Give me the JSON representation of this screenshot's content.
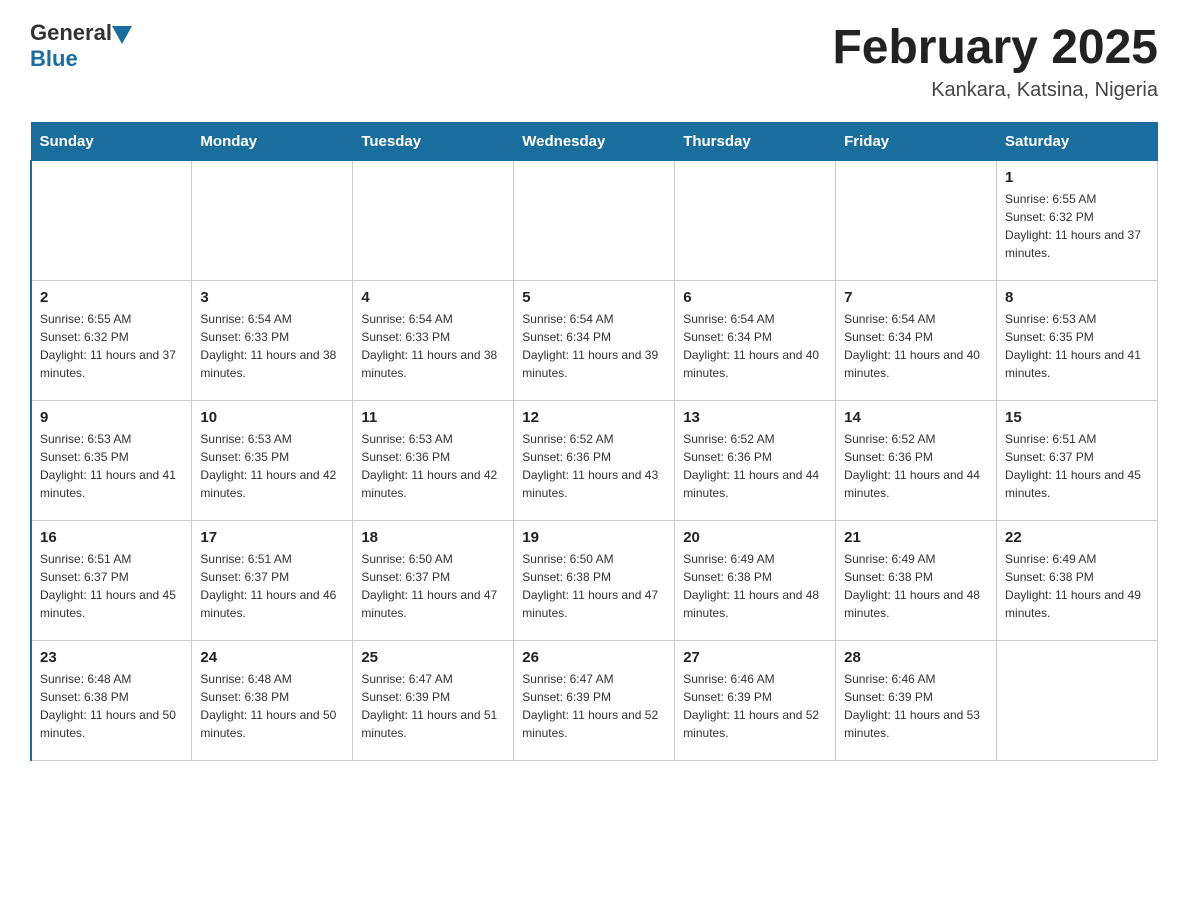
{
  "logo": {
    "general": "General",
    "blue": "Blue"
  },
  "title": "February 2025",
  "subtitle": "Kankara, Katsina, Nigeria",
  "weekdays": [
    "Sunday",
    "Monday",
    "Tuesday",
    "Wednesday",
    "Thursday",
    "Friday",
    "Saturday"
  ],
  "weeks": [
    [
      {
        "day": "",
        "info": ""
      },
      {
        "day": "",
        "info": ""
      },
      {
        "day": "",
        "info": ""
      },
      {
        "day": "",
        "info": ""
      },
      {
        "day": "",
        "info": ""
      },
      {
        "day": "",
        "info": ""
      },
      {
        "day": "1",
        "info": "Sunrise: 6:55 AM\nSunset: 6:32 PM\nDaylight: 11 hours and 37 minutes."
      }
    ],
    [
      {
        "day": "2",
        "info": "Sunrise: 6:55 AM\nSunset: 6:32 PM\nDaylight: 11 hours and 37 minutes."
      },
      {
        "day": "3",
        "info": "Sunrise: 6:54 AM\nSunset: 6:33 PM\nDaylight: 11 hours and 38 minutes."
      },
      {
        "day": "4",
        "info": "Sunrise: 6:54 AM\nSunset: 6:33 PM\nDaylight: 11 hours and 38 minutes."
      },
      {
        "day": "5",
        "info": "Sunrise: 6:54 AM\nSunset: 6:34 PM\nDaylight: 11 hours and 39 minutes."
      },
      {
        "day": "6",
        "info": "Sunrise: 6:54 AM\nSunset: 6:34 PM\nDaylight: 11 hours and 40 minutes."
      },
      {
        "day": "7",
        "info": "Sunrise: 6:54 AM\nSunset: 6:34 PM\nDaylight: 11 hours and 40 minutes."
      },
      {
        "day": "8",
        "info": "Sunrise: 6:53 AM\nSunset: 6:35 PM\nDaylight: 11 hours and 41 minutes."
      }
    ],
    [
      {
        "day": "9",
        "info": "Sunrise: 6:53 AM\nSunset: 6:35 PM\nDaylight: 11 hours and 41 minutes."
      },
      {
        "day": "10",
        "info": "Sunrise: 6:53 AM\nSunset: 6:35 PM\nDaylight: 11 hours and 42 minutes."
      },
      {
        "day": "11",
        "info": "Sunrise: 6:53 AM\nSunset: 6:36 PM\nDaylight: 11 hours and 42 minutes."
      },
      {
        "day": "12",
        "info": "Sunrise: 6:52 AM\nSunset: 6:36 PM\nDaylight: 11 hours and 43 minutes."
      },
      {
        "day": "13",
        "info": "Sunrise: 6:52 AM\nSunset: 6:36 PM\nDaylight: 11 hours and 44 minutes."
      },
      {
        "day": "14",
        "info": "Sunrise: 6:52 AM\nSunset: 6:36 PM\nDaylight: 11 hours and 44 minutes."
      },
      {
        "day": "15",
        "info": "Sunrise: 6:51 AM\nSunset: 6:37 PM\nDaylight: 11 hours and 45 minutes."
      }
    ],
    [
      {
        "day": "16",
        "info": "Sunrise: 6:51 AM\nSunset: 6:37 PM\nDaylight: 11 hours and 45 minutes."
      },
      {
        "day": "17",
        "info": "Sunrise: 6:51 AM\nSunset: 6:37 PM\nDaylight: 11 hours and 46 minutes."
      },
      {
        "day": "18",
        "info": "Sunrise: 6:50 AM\nSunset: 6:37 PM\nDaylight: 11 hours and 47 minutes."
      },
      {
        "day": "19",
        "info": "Sunrise: 6:50 AM\nSunset: 6:38 PM\nDaylight: 11 hours and 47 minutes."
      },
      {
        "day": "20",
        "info": "Sunrise: 6:49 AM\nSunset: 6:38 PM\nDaylight: 11 hours and 48 minutes."
      },
      {
        "day": "21",
        "info": "Sunrise: 6:49 AM\nSunset: 6:38 PM\nDaylight: 11 hours and 48 minutes."
      },
      {
        "day": "22",
        "info": "Sunrise: 6:49 AM\nSunset: 6:38 PM\nDaylight: 11 hours and 49 minutes."
      }
    ],
    [
      {
        "day": "23",
        "info": "Sunrise: 6:48 AM\nSunset: 6:38 PM\nDaylight: 11 hours and 50 minutes."
      },
      {
        "day": "24",
        "info": "Sunrise: 6:48 AM\nSunset: 6:38 PM\nDaylight: 11 hours and 50 minutes."
      },
      {
        "day": "25",
        "info": "Sunrise: 6:47 AM\nSunset: 6:39 PM\nDaylight: 11 hours and 51 minutes."
      },
      {
        "day": "26",
        "info": "Sunrise: 6:47 AM\nSunset: 6:39 PM\nDaylight: 11 hours and 52 minutes."
      },
      {
        "day": "27",
        "info": "Sunrise: 6:46 AM\nSunset: 6:39 PM\nDaylight: 11 hours and 52 minutes."
      },
      {
        "day": "28",
        "info": "Sunrise: 6:46 AM\nSunset: 6:39 PM\nDaylight: 11 hours and 53 minutes."
      },
      {
        "day": "",
        "info": ""
      }
    ]
  ]
}
